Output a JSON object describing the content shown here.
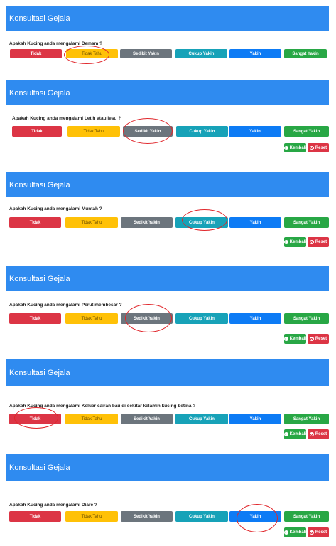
{
  "header_title": "Konsultasi Gejala",
  "answer_options": {
    "tidak": "Tidak",
    "tidak_tahu": "Tidak Tahu",
    "sedikit_yakin": "Sedikit Yakin",
    "cukup_yakin": "Cukup Yakin",
    "yakin": "Yakin",
    "sangat_yakin": "Sangat Yakin"
  },
  "actions": {
    "kembali": "Kembali",
    "reset": "Reset"
  },
  "colors": {
    "header": "#2f8bf0",
    "tidak": "#dc3545",
    "tidak_tahu": "#ffc107",
    "sedikit_yakin": "#6c757d",
    "cukup_yakin": "#17a2b8",
    "yakin": "#0d7bf5",
    "sangat_yakin": "#28a745",
    "annotation": "#e0262b"
  },
  "panels": [
    {
      "question": "Apakah Kucing anda mengalami Demam ?",
      "selected": "tidak_tahu"
    },
    {
      "question": "Apakah Kucing anda mengalami Letih atau lesu ?",
      "selected": "sedikit_yakin"
    },
    {
      "question": "Apakah Kucing anda mengalami Muntah ?",
      "selected": "cukup_yakin"
    },
    {
      "question": "Apakah Kucing anda mengalami Perut membesar ?",
      "selected": "sedikit_yakin"
    },
    {
      "question": "Apakah Kucing anda mengalami Keluar cairan bau di sekitar kelamin kucing betina ?",
      "selected": "tidak"
    },
    {
      "question": "Apakah Kucing anda mengalami Diare ?",
      "selected": "yakin"
    }
  ]
}
